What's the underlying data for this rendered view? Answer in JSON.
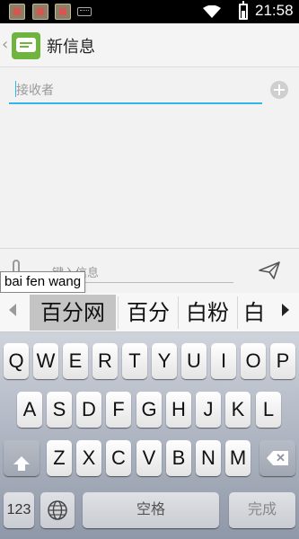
{
  "status_bar": {
    "time": "21:58"
  },
  "header": {
    "title": "新信息"
  },
  "recipient": {
    "placeholder": "接收者"
  },
  "compose": {
    "placeholder": "键入信息"
  },
  "pinyin": {
    "text": "bai fen wang"
  },
  "candidates": [
    "百分网",
    "百分",
    "白粉",
    "白"
  ],
  "keyboard": {
    "row1": [
      "Q",
      "W",
      "E",
      "R",
      "T",
      "Y",
      "U",
      "I",
      "O",
      "P"
    ],
    "row2": [
      "A",
      "S",
      "D",
      "F",
      "G",
      "H",
      "J",
      "K",
      "L"
    ],
    "row3": [
      "Z",
      "X",
      "C",
      "V",
      "B",
      "N",
      "M"
    ],
    "numbers_label": "123",
    "space_label": "空格",
    "done_label": "完成"
  },
  "colors": {
    "accent": "#33b5e5",
    "app_icon": "#6fb43f"
  }
}
